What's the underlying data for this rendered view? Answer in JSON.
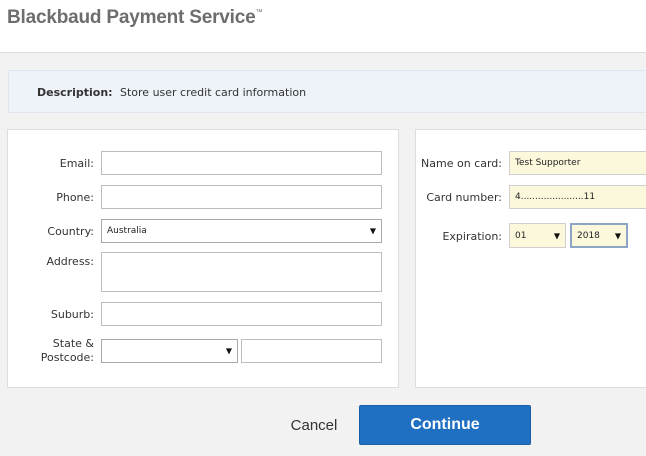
{
  "header": {
    "brand": "Blackbaud Payment Service",
    "trademark": "™"
  },
  "description": {
    "label": "Description:",
    "value": "Store user credit card information"
  },
  "billing": {
    "email_label": "Email:",
    "email_value": "",
    "phone_label": "Phone:",
    "phone_value": "",
    "country_label": "Country:",
    "country_value": "Australia",
    "address_label": "Address:",
    "address_value": "",
    "suburb_label": "Suburb:",
    "suburb_value": "",
    "state_label_line1": "State &",
    "state_label_line2": "Postcode:",
    "state_value": "",
    "postcode_value": ""
  },
  "card": {
    "name_label": "Name on card:",
    "name_value": "Test Supporter",
    "number_label": "Card number:",
    "number_value": "4......................11",
    "expiration_label": "Expiration:",
    "exp_month": "01",
    "exp_year": "2018"
  },
  "actions": {
    "cancel_label": "Cancel",
    "continue_label": "Continue"
  },
  "colors": {
    "primary": "#1f6fc2",
    "field_highlight": "#fcf8dc",
    "description_bg": "#eef3fa"
  }
}
